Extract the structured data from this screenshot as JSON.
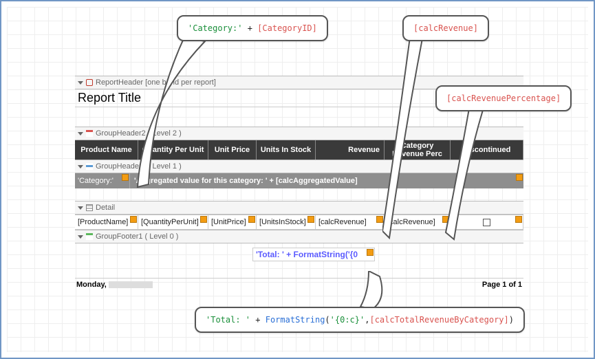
{
  "bands": {
    "reportHeader": "ReportHeader [one band per report]",
    "groupHeader2": "GroupHeader2 ( Level 2 )",
    "groupHeader1": "GroupHeader1 ( Level 1 )",
    "detail": "Detail",
    "groupFooter1": "GroupFooter1 ( Level 0 )"
  },
  "reportTitle": "Report Title",
  "columns": {
    "productName": "Product Name",
    "qtyPerUnit": "Quantity Per Unit",
    "unitPrice": "Unit Price",
    "unitsInStock": "Units In Stock",
    "revenue": "Revenue",
    "revenuePerc": "Category Revenue Perc",
    "discontinued": "Discontinued"
  },
  "groupHeader1Row": {
    "category": "'Category:'",
    "aggregated": "'Aggregated value for this category: ' + [calcAggregatedValue]"
  },
  "detailRow": {
    "productName": "[ProductName]",
    "qtyPerUnit": "[QuantityPerUnit]",
    "unitPrice": "[UnitPrice]",
    "unitsInStock": "[UnitsInStock]",
    "calcRevenue": "[calcRevenue]",
    "calcRevenuePerc": "[calcRevenue]"
  },
  "footerTotal": "'Total: ' + FormatString('{0",
  "pageFooter": {
    "left": "Monday,",
    "right": "Page 1 of 1"
  },
  "callouts": {
    "category_str": "'Category:'",
    "category_op": " + ",
    "category_fld": "[CategoryID]",
    "calcRevenue": "[calcRevenue]",
    "calcRevenuePerc": "[calcRevenuePercentage]",
    "total_str": "'Total: '",
    "total_op1": " + ",
    "total_fn": "FormatString",
    "total_args_open": "(",
    "total_args_str": "'{0:c}'",
    "total_args_sep": ",",
    "total_args_fld": "[calcTotalRevenueByCategory]",
    "total_args_close": ")"
  }
}
